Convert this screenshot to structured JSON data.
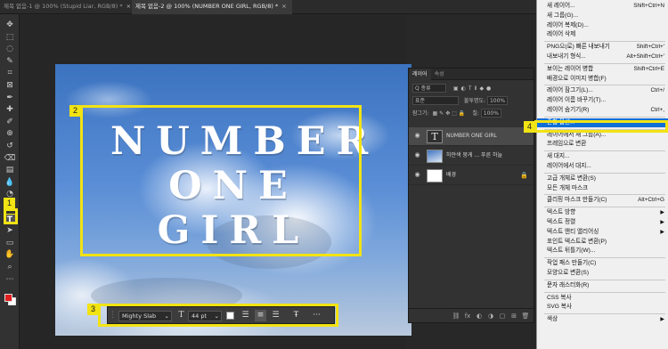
{
  "tabs": [
    {
      "label": "제목 없음-1 @ 100% (Stupid Liar, RGB/8) *",
      "active": false
    },
    {
      "label": "제목 없음-2 @ 100% (NUMBER ONE GIRL, RGB/8) *",
      "active": true
    }
  ],
  "toolbar": {
    "tools": [
      "move-icon",
      "marquee-icon",
      "lasso-icon",
      "quick-select-icon",
      "crop-icon",
      "frame-icon",
      "eyedropper-icon",
      "healing-icon",
      "brush-icon",
      "stamp-icon",
      "history-brush-icon",
      "eraser-icon",
      "gradient-icon",
      "blur-icon",
      "dodge-icon",
      "pen-icon",
      "type-icon",
      "path-select-icon",
      "rectangle-icon",
      "hand-icon",
      "zoom-icon",
      "more-icon"
    ],
    "glyphs": [
      "✥",
      "⬚",
      "◌",
      "✎",
      "⌗",
      "⊠",
      "✒",
      "✚",
      "✐",
      "⊕",
      "↺",
      "⌫",
      "▤",
      "💧",
      "◔",
      "✑",
      "T",
      "➤",
      "▭",
      "✋",
      "⌕",
      "⋯"
    ],
    "selected_index": 16,
    "foreground_color": "#e11d1d",
    "background_color": "#ffffff"
  },
  "canvas": {
    "headline_lines": [
      "NUMBER",
      "ONE",
      "GIRL"
    ],
    "sky_color": "#4a80cc"
  },
  "annotations": {
    "badges": [
      "1",
      "2",
      "3",
      "4"
    ],
    "highlight_color": "#f2e313"
  },
  "context_bar": {
    "font": "Mighty Slab",
    "size": "44 pt",
    "more": "···",
    "size_icon": "T",
    "color_swatch": "#ffffff"
  },
  "layers_panel": {
    "tabs": [
      "레이어",
      "속성"
    ],
    "filter_label": "Q 종류",
    "blend_mode": "표준",
    "opacity_label": "불투명도:",
    "opacity_value": "100%",
    "lock_label": "잠그기:",
    "fill_label": "칠:",
    "fill_value": "100%",
    "layers": [
      {
        "name": "NUMBER ONE GIRL",
        "kind": "text",
        "selected": true
      },
      {
        "name": "하얀색 뭉게 ... 푸른 하늘",
        "kind": "photo",
        "selected": false
      },
      {
        "name": "배경",
        "kind": "background",
        "selected": false,
        "locked": true
      }
    ],
    "footer_icons": [
      "link-icon",
      "fx-icon",
      "mask-icon",
      "adjustment-icon",
      "group-icon",
      "new-layer-icon",
      "trash-icon"
    ],
    "footer_glyphs": [
      "⛓",
      "fx",
      "◐",
      "◑",
      "▢",
      "⊞",
      "🗑"
    ]
  },
  "menu": {
    "items": [
      {
        "label": "새 레이어...",
        "shortcut": "Shift+Ctrl+N"
      },
      {
        "label": "새 그룹(G)...",
        "shortcut": ""
      },
      {
        "label": "레이어 복제(D)...",
        "shortcut": ""
      },
      {
        "label": "레이어 삭제",
        "shortcut": ""
      },
      {
        "sep": true
      },
      {
        "label": "PNG으(로) 빠른 내보내기",
        "shortcut": "Shift+Ctrl+'"
      },
      {
        "label": "내보내기 형식...",
        "shortcut": "Alt+Shift+Ctrl+'"
      },
      {
        "sep": true
      },
      {
        "label": "보이는 레이어 병합",
        "shortcut": "Shift+Ctrl+E"
      },
      {
        "label": "배경으로 이미지 병합(F)",
        "shortcut": ""
      },
      {
        "sep": true
      },
      {
        "label": "레이어 잠그기(L)...",
        "shortcut": "Ctrl+/"
      },
      {
        "label": "레이어 이름 바꾸기(T)...",
        "shortcut": ""
      },
      {
        "label": "레이어 숨기기(R)",
        "shortcut": "Ctrl+,"
      },
      {
        "sep": true
      },
      {
        "label": "혼합 옵션...",
        "shortcut": "",
        "highlight": true
      },
      {
        "sep": true
      },
      {
        "label": "레이어에서 새 그룹(A)...",
        "shortcut": ""
      },
      {
        "label": "프레임으로 변환",
        "shortcut": ""
      },
      {
        "sep": true
      },
      {
        "label": "새 대지...",
        "shortcut": ""
      },
      {
        "label": "레이어에서 대지...",
        "shortcut": ""
      },
      {
        "sep": true
      },
      {
        "label": "고급 개체로 변환(S)",
        "shortcut": ""
      },
      {
        "label": "모든 개체 마스크",
        "shortcut": ""
      },
      {
        "sep": true
      },
      {
        "label": "클리핑 마스크 만들기(C)",
        "shortcut": "Alt+Ctrl+G"
      },
      {
        "sep": true
      },
      {
        "label": "텍스트 방향",
        "shortcut": "",
        "submenu": true
      },
      {
        "label": "텍스트 정렬",
        "shortcut": "",
        "submenu": true
      },
      {
        "label": "텍스트 앤티 앨리어싱",
        "shortcut": "",
        "submenu": true
      },
      {
        "label": "포인트 텍스트로 변환(P)",
        "shortcut": ""
      },
      {
        "label": "텍스트 뒤틀기(W)...",
        "shortcut": ""
      },
      {
        "sep": true
      },
      {
        "label": "작업 패스 만들기(C)",
        "shortcut": ""
      },
      {
        "label": "모양으로 변환(S)",
        "shortcut": ""
      },
      {
        "sep": true
      },
      {
        "label": "문자 래스터화(R)",
        "shortcut": ""
      },
      {
        "sep": true
      },
      {
        "label": "CSS 복사",
        "shortcut": ""
      },
      {
        "label": "SVG 복사",
        "shortcut": ""
      },
      {
        "sep": true
      },
      {
        "label": "색상",
        "shortcut": "",
        "submenu": true
      }
    ],
    "arrow_glyph": "▶"
  }
}
